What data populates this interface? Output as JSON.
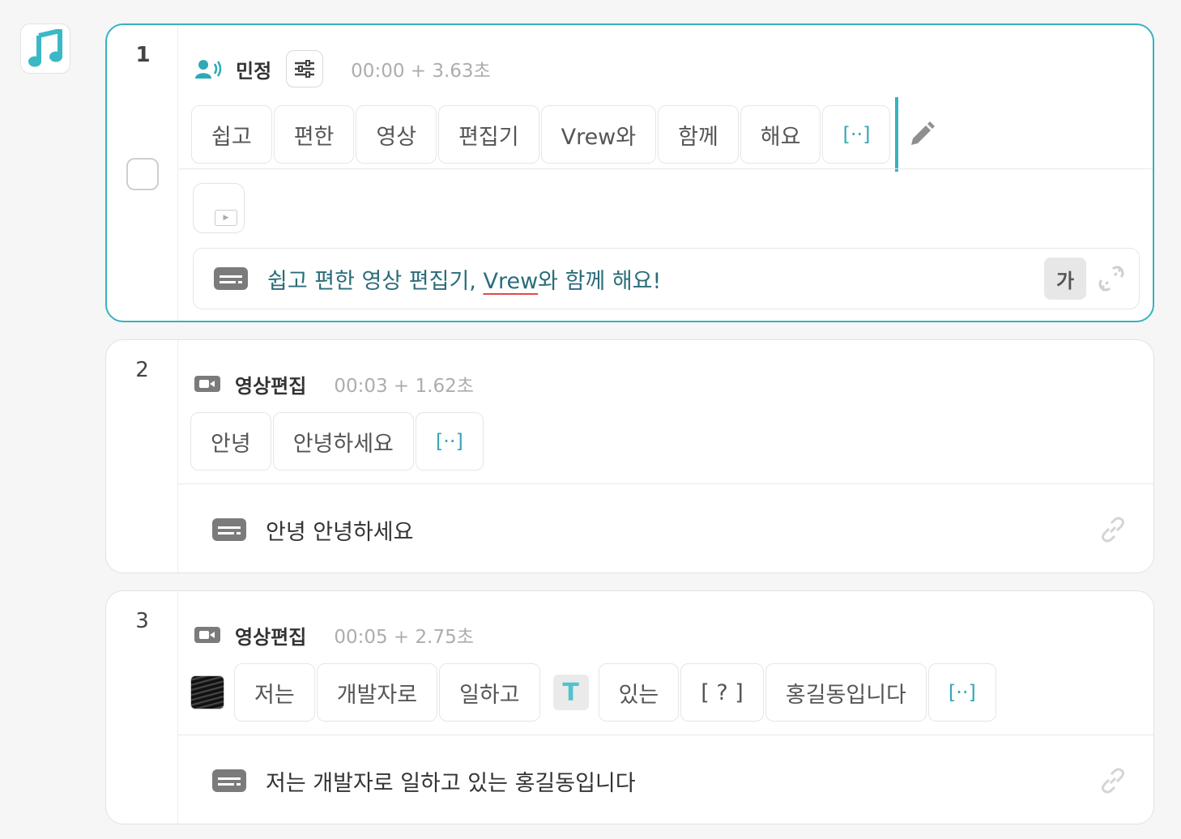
{
  "music_button": {
    "icon": "music-note-icon"
  },
  "clips": [
    {
      "index": "1",
      "selected": true,
      "speaker": "민정",
      "speaker_icon": "speaker-voice-icon",
      "timecode": "00:00 + 3.63초",
      "words": [
        "쉽고",
        "편한",
        "영상",
        "편집기",
        "Vrew와",
        "함께",
        "해요",
        "[··]"
      ],
      "caption": {
        "before": "쉽고 편한 영상 편집기, ",
        "highlight": "Vrew",
        "after": "와 함께 해요!"
      },
      "font_button": "가"
    },
    {
      "index": "2",
      "selected": false,
      "speaker": "영상편집",
      "speaker_icon": "video-camera-icon",
      "timecode": "00:03 + 1.62초",
      "words": [
        "안녕",
        "안녕하세요",
        "[··]"
      ],
      "caption": "안녕 안녕하세요"
    },
    {
      "index": "3",
      "selected": false,
      "speaker": "영상편집",
      "speaker_icon": "video-camera-icon",
      "timecode": "00:05 + 2.75초",
      "words_a": [
        "저는",
        "개발자로",
        "일하고"
      ],
      "text_badge": "T",
      "words_b": [
        "있는",
        "[ ? ]",
        "홍길동입니다",
        "[··]"
      ],
      "caption": "저는 개발자로 일하고 있는 홍길동입니다"
    }
  ],
  "colors": {
    "accent": "#35b3c0",
    "silence": "#35a8b6",
    "caption_active": "#2a6d7a",
    "spell_underline": "#e24a4a"
  }
}
